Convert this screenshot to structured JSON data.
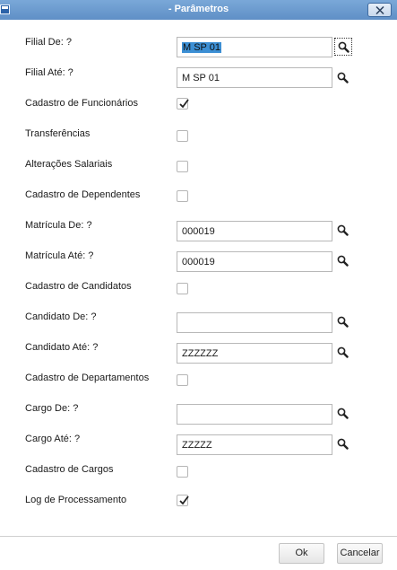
{
  "window": {
    "title": "- Parâmetros"
  },
  "fields": {
    "filial_de": {
      "label": "Filial De:  ?",
      "value": "M SP 01"
    },
    "filial_ate": {
      "label": "Filial Até:  ?",
      "value": "M SP 01"
    },
    "cad_funcionarios": {
      "label": "Cadastro de Funcionários",
      "checked": true
    },
    "transferencias": {
      "label": "Transferências",
      "checked": false
    },
    "alteracoes_salariais": {
      "label": "Alterações Salariais",
      "checked": false
    },
    "cad_dependentes": {
      "label": "Cadastro de Dependentes",
      "checked": false
    },
    "matricula_de": {
      "label": "Matrícula De:  ?",
      "value": "000019"
    },
    "matricula_ate": {
      "label": "Matrícula Até:  ?",
      "value": "000019"
    },
    "cad_candidatos": {
      "label": "Cadastro de Candidatos",
      "checked": false
    },
    "candidato_de": {
      "label": "Candidato De:  ?",
      "value": ""
    },
    "candidato_ate": {
      "label": "Candidato Até:  ?",
      "value": "ZZZZZZ"
    },
    "cad_departamentos": {
      "label": "Cadastro de Departamentos",
      "checked": false
    },
    "cargo_de": {
      "label": "Cargo De:  ?",
      "value": ""
    },
    "cargo_ate": {
      "label": "Cargo Até:  ?",
      "value": "ZZZZZ"
    },
    "cad_cargos": {
      "label": "Cadastro de Cargos",
      "checked": false
    },
    "log_processamento": {
      "label": "Log de Processamento",
      "checked": true
    }
  },
  "buttons": {
    "ok": "Ok",
    "cancel": "Cancelar"
  },
  "colors": {
    "titlebar": "#6a9ad0",
    "selection": "#3c8fd4"
  }
}
